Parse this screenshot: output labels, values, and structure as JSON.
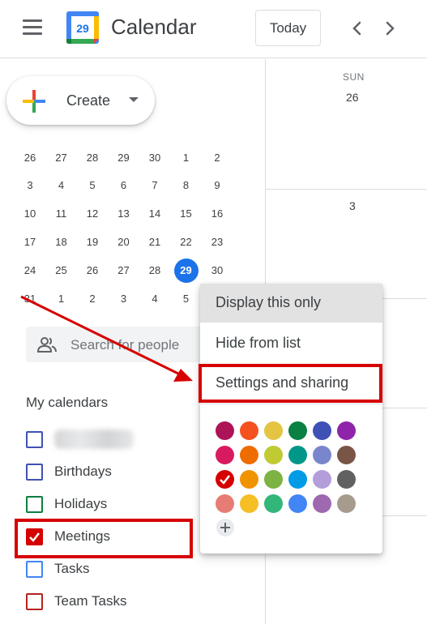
{
  "header": {
    "app_title": "Calendar",
    "logo_day": "29",
    "today_label": "Today",
    "menu_icon": "hamburger-menu-icon",
    "prev_icon": "chevron-left-icon",
    "next_icon": "chevron-right-icon"
  },
  "sidebar": {
    "create_label": "Create",
    "mini_calendar": {
      "weeks": [
        [
          "26",
          "27",
          "28",
          "29",
          "30",
          "1",
          "2"
        ],
        [
          "3",
          "4",
          "5",
          "6",
          "7",
          "8",
          "9"
        ],
        [
          "10",
          "11",
          "12",
          "13",
          "14",
          "15",
          "16"
        ],
        [
          "17",
          "18",
          "19",
          "20",
          "21",
          "22",
          "23"
        ],
        [
          "24",
          "25",
          "26",
          "27",
          "28",
          "29",
          "30"
        ],
        [
          "31",
          "1",
          "2",
          "3",
          "4",
          "5",
          "6"
        ]
      ],
      "today": "29"
    },
    "search_people_placeholder": "Search for people",
    "my_calendars_title": "My calendars",
    "calendars": [
      {
        "label": "",
        "color": "#3f51b5",
        "checked": false,
        "blurred": true
      },
      {
        "label": "Birthdays",
        "color": "#3f51b5",
        "checked": false
      },
      {
        "label": "Holidays",
        "color": "#0b8043",
        "checked": false
      },
      {
        "label": "Meetings",
        "color": "#d50000",
        "checked": true
      },
      {
        "label": "Tasks",
        "color": "#4285f4",
        "checked": false
      },
      {
        "label": "Team Tasks",
        "color": "#b7221f",
        "checked": false
      }
    ]
  },
  "grid": {
    "day_name": "SUN",
    "day_numbers": [
      "26",
      "3"
    ]
  },
  "context_menu": {
    "items": [
      {
        "label": "Display this only"
      },
      {
        "label": "Hide from list"
      },
      {
        "label": "Settings and sharing"
      }
    ],
    "colors": [
      [
        "#ad1457",
        "#f4511e",
        "#e4c441",
        "#0b8043",
        "#3f51b5",
        "#8e24aa"
      ],
      [
        "#d81b60",
        "#ef6c00",
        "#c0ca33",
        "#009688",
        "#7986cb",
        "#795548"
      ],
      [
        "#d50000",
        "#f09300",
        "#7cb342",
        "#039be5",
        "#b39ddb",
        "#616161"
      ],
      [
        "#e67c73",
        "#f6bf26",
        "#33b679",
        "#4285f4",
        "#9e69af",
        "#a79b8e"
      ]
    ],
    "selected_color": "#d50000",
    "add_color_icon": "plus-icon"
  },
  "annotations": {
    "highlight_color": "#d60000"
  }
}
